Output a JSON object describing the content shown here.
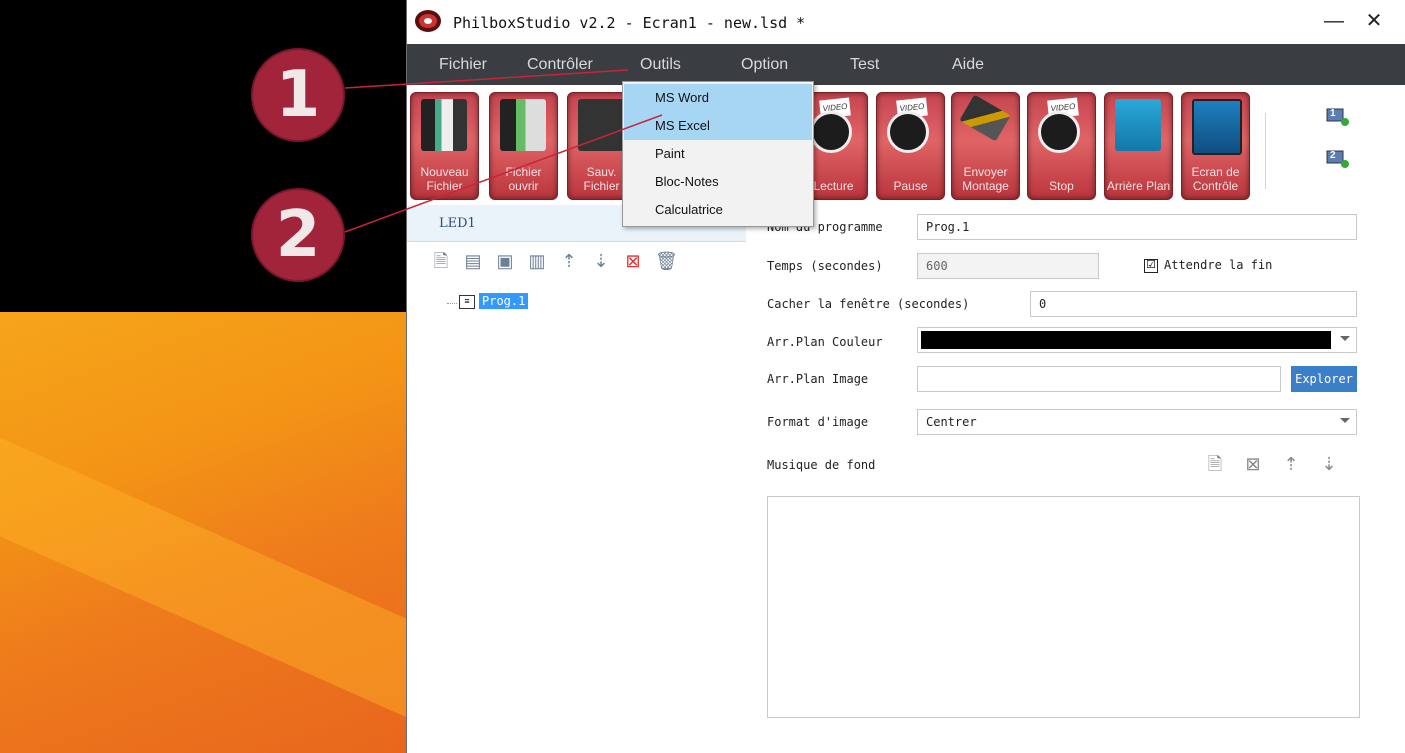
{
  "window": {
    "title": "PhilboxStudio v2.2 - Ecran1 - new.lsd *",
    "minimize": "—",
    "close": "✕"
  },
  "menu": {
    "fichier": "Fichier",
    "controler": "Contrôler",
    "outils": "Outils",
    "option": "Option",
    "test": "Test",
    "aide": "Aide"
  },
  "toolbar": {
    "nouveau": "Nouveau Fichier",
    "ouvrir": "Fichier ouvrir",
    "sauv": "Sauv. Fichier",
    "lecture": "Lecture",
    "pause": "Pause",
    "envoyer": "Envoyer Montage",
    "stop": "Stop",
    "arriere": "Arrière Plan",
    "ecran": "Ecran de Contrôle",
    "video_badge": "VIDEO",
    "monitor1": "1",
    "monitor2": "2"
  },
  "outils_menu": {
    "items": [
      "MS Word",
      "MS Excel",
      "Paint",
      "Bloc-Notes",
      "Calculatrice"
    ]
  },
  "left_panel": {
    "tab": "LED1",
    "tree_item": "Prog.1"
  },
  "form": {
    "name_label": "Nom du programme",
    "name_value": "Prog.1",
    "time_label": "Temps (secondes)",
    "time_value": "600",
    "wait_label": "Attendre la fin",
    "wait_checked": "☑",
    "hide_label": "Cacher la fenêtre (secondes)",
    "hide_value": "0",
    "bgcolor_label": "Arr.Plan Couleur",
    "bgcolor_value": "#000000",
    "bgimage_label": "Arr.Plan Image",
    "bgimage_value": "",
    "explore_label": "Explorer",
    "format_label": "Format d'image",
    "format_value": "Centrer",
    "music_label": "Musique de fond"
  },
  "callouts": {
    "one": "1",
    "two": "2"
  },
  "colors": {
    "menubar": "#3a3d42",
    "accent": "#a2243a",
    "highlight": "#a7d6f5",
    "selection": "#3399ff"
  }
}
